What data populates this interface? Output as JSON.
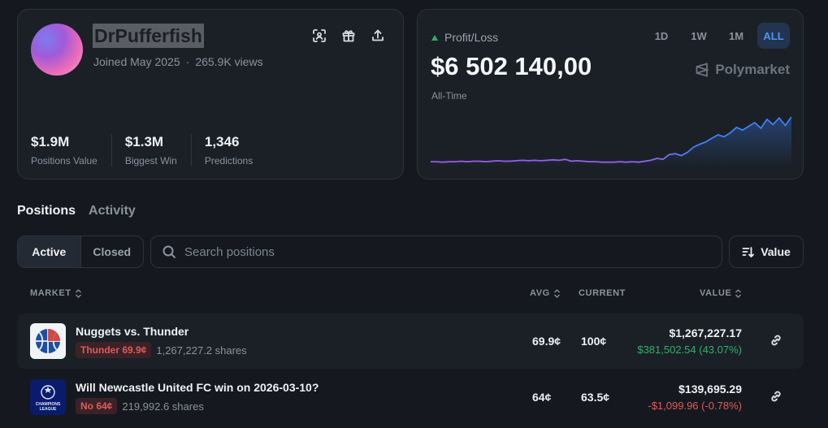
{
  "profile": {
    "username": "DrPufferfish",
    "joined": "Joined May 2025",
    "views": "265.9K views",
    "separator": "·",
    "icons": [
      "scan-icon",
      "gift-icon",
      "share-icon"
    ],
    "stats": [
      {
        "value": "$1.9M",
        "label": "Positions Value"
      },
      {
        "value": "$1.3M",
        "label": "Biggest Win"
      },
      {
        "value": "1,346",
        "label": "Predictions"
      }
    ]
  },
  "pnl": {
    "label": "Profit/Loss",
    "value": "$6 502 140,00",
    "period": "All-Time",
    "brand": "Polymarket",
    "ranges": [
      "1D",
      "1W",
      "1M",
      "ALL"
    ],
    "active_range": "ALL",
    "colors": {
      "up": "#2fb167",
      "line_start": "#9b5de5",
      "line_end": "#3b82f6"
    }
  },
  "chart_data": {
    "type": "line",
    "x": [
      0,
      1,
      2,
      3,
      4,
      5,
      6,
      7,
      8,
      9,
      10,
      11,
      12,
      13,
      14,
      15,
      16,
      17,
      18,
      19,
      20,
      21,
      22,
      23,
      24,
      25,
      26,
      27,
      28,
      29,
      30,
      31,
      32,
      33,
      34,
      35,
      36,
      37,
      38,
      39,
      40,
      41,
      42,
      43,
      44,
      45,
      46,
      47,
      48,
      49,
      50,
      51,
      52,
      53,
      54,
      55,
      56,
      57,
      58,
      59
    ],
    "values": [
      0.05,
      0.05,
      0.04,
      0.05,
      0.05,
      0.06,
      0.05,
      0.06,
      0.06,
      0.05,
      0.06,
      0.07,
      0.06,
      0.06,
      0.07,
      0.08,
      0.07,
      0.08,
      0.07,
      0.08,
      0.09,
      0.08,
      0.1,
      0.06,
      0.07,
      0.06,
      0.05,
      0.05,
      0.04,
      0.04,
      0.04,
      0.05,
      0.04,
      0.05,
      0.04,
      0.06,
      0.08,
      0.12,
      0.1,
      0.2,
      0.22,
      0.18,
      0.25,
      0.36,
      0.42,
      0.47,
      0.55,
      0.62,
      0.58,
      0.66,
      0.78,
      0.72,
      0.8,
      0.88,
      0.76,
      0.95,
      0.84,
      0.98,
      0.82,
      1.0
    ],
    "ylabel": "",
    "xlabel": "",
    "grid": false
  },
  "tabs": {
    "items": [
      "Positions",
      "Activity"
    ],
    "active": "Positions"
  },
  "filters": {
    "toggle": [
      "Active",
      "Closed"
    ],
    "active": "Active",
    "search_placeholder": "Search positions",
    "sort_label": "Value"
  },
  "table": {
    "headers": {
      "market": "MARKET",
      "avg": "AVG",
      "current": "CURRENT",
      "value": "VALUE"
    },
    "rows": [
      {
        "title": "Nuggets vs. Thunder",
        "outcome": "Thunder 69.9¢",
        "shares": "1,267,227.2 shares",
        "avg": "69.9¢",
        "current": "100¢",
        "value": "$1,267,227.17",
        "pnl": "$381,502.54 (43.07%)",
        "icon": "basketball-icon"
      },
      {
        "title": "Will Newcastle United FC win on 2026-03-10?",
        "outcome": "No 64¢",
        "shares": "219,992.6 shares",
        "avg": "64¢",
        "current": "63.5¢",
        "value": "$139,695.29",
        "pnl": "-$1,099.96 (-0.78%)",
        "icon": "champions-league-icon",
        "icon_text": [
          "CHAMPIONS",
          "LEAGUE"
        ]
      }
    ]
  }
}
